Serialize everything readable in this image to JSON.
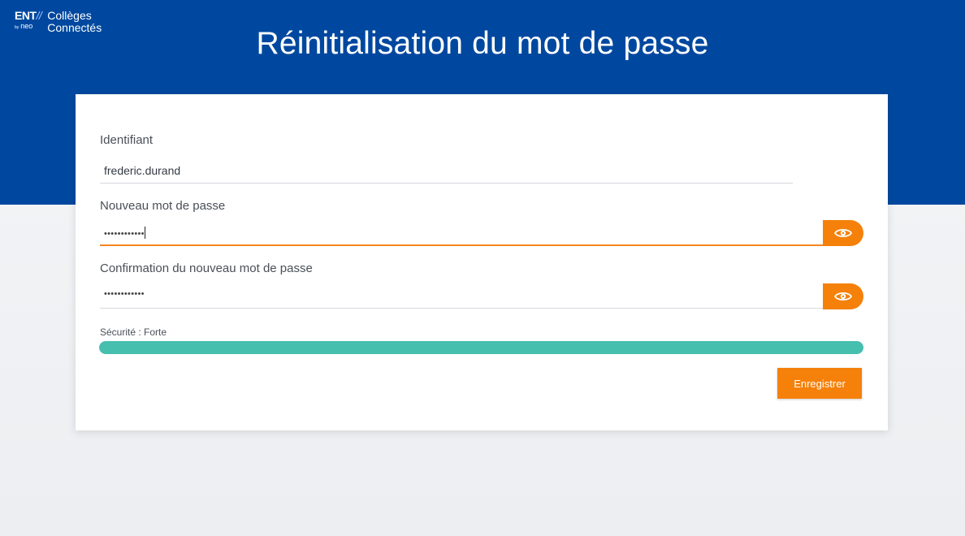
{
  "logo": {
    "ent": "ENT",
    "slashes": "//",
    "by": "by",
    "neo": "neo",
    "line1": "Collèges",
    "line2": "Connectés"
  },
  "title": "Réinitialisation du mot de passe",
  "form": {
    "identifier_label": "Identifiant",
    "identifier_value": "frederic.durand",
    "new_password_label": "Nouveau mot de passe",
    "new_password_masked": "••••••••••••",
    "confirm_label": "Confirmation du nouveau mot de passe",
    "confirm_password_masked": "••••••••••••",
    "eye_icon": "eye-icon",
    "strength_label": "Sécurité : Forte",
    "strength_level": 1.0,
    "strength_color": "#46bfaf",
    "save_label": "Enregistrer"
  },
  "colors": {
    "header": "#00489f",
    "accent": "#f5810a",
    "focus": "#f5871f"
  }
}
